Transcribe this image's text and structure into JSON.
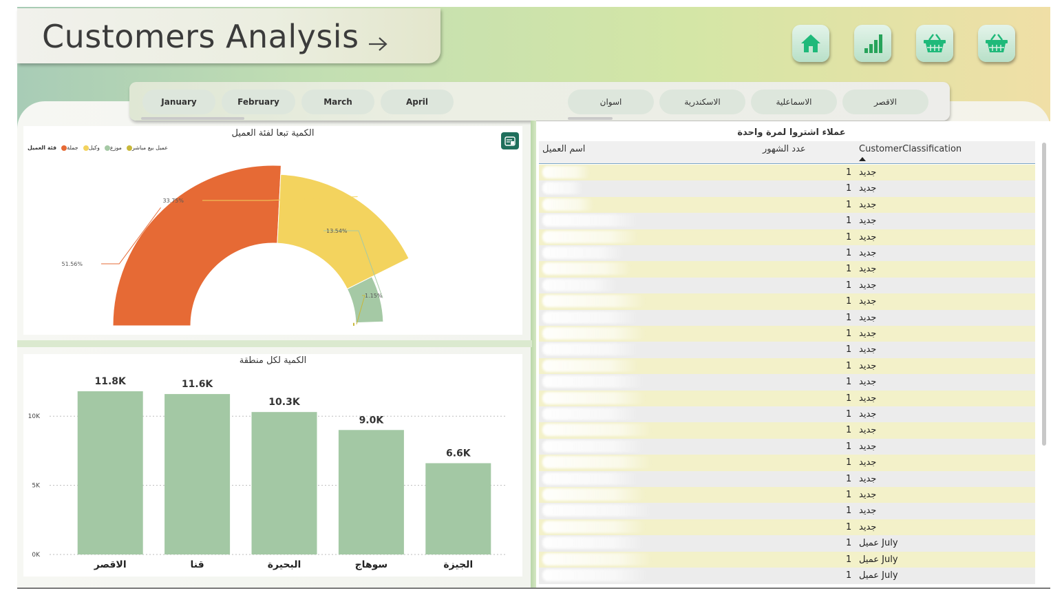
{
  "header": {
    "title": "Customers Analysis"
  },
  "nav": [
    {
      "icon": "home-icon"
    },
    {
      "icon": "bar-chart-icon"
    },
    {
      "icon": "basket-icon"
    },
    {
      "icon": "basket-icon"
    }
  ],
  "month_slicer": [
    "January",
    "February",
    "March",
    "April"
  ],
  "region_slicer": [
    "اسوان",
    "الاسكندرية",
    "الاسماعلية",
    "الاقصر"
  ],
  "colors": {
    "orange": "#e66a35",
    "yellow": "#f3d35e",
    "green": "#a5c9a5",
    "olive": "#c8b83a",
    "bar": "#a3c8a4",
    "accent": "#1f6f5c"
  },
  "donut_panel": {
    "title": "الكمية تبعا لفئة العميل",
    "legend_title": "فئة العميل",
    "legend": [
      {
        "label": "جملة",
        "color": "#e66a35"
      },
      {
        "label": "وكيل",
        "color": "#f3d35e"
      },
      {
        "label": "موزع",
        "color": "#a5c9a5"
      },
      {
        "label": "عميل بيع مباشر",
        "color": "#c8b83a"
      }
    ]
  },
  "bar_panel": {
    "title": "الكمية لكل منطقة"
  },
  "table": {
    "title": "عملاء اشتروا لمرة واحدة",
    "headers": {
      "name": "اسم العميل",
      "months": "عدد الشهور",
      "classification": "CustomerClassification"
    },
    "rows": [
      {
        "months": "1",
        "cls": "جديد"
      },
      {
        "months": "1",
        "cls": "جديد"
      },
      {
        "months": "1",
        "cls": "جديد"
      },
      {
        "months": "1",
        "cls": "جديد"
      },
      {
        "months": "1",
        "cls": "جديد"
      },
      {
        "months": "1",
        "cls": "جديد"
      },
      {
        "months": "1",
        "cls": "جديد"
      },
      {
        "months": "1",
        "cls": "جديد"
      },
      {
        "months": "1",
        "cls": "جديد"
      },
      {
        "months": "1",
        "cls": "جديد"
      },
      {
        "months": "1",
        "cls": "جديد"
      },
      {
        "months": "1",
        "cls": "جديد"
      },
      {
        "months": "1",
        "cls": "جديد"
      },
      {
        "months": "1",
        "cls": "جديد"
      },
      {
        "months": "1",
        "cls": "جديد"
      },
      {
        "months": "1",
        "cls": "جديد"
      },
      {
        "months": "1",
        "cls": "جديد"
      },
      {
        "months": "1",
        "cls": "جديد"
      },
      {
        "months": "1",
        "cls": "جديد"
      },
      {
        "months": "1",
        "cls": "جديد"
      },
      {
        "months": "1",
        "cls": "جديد"
      },
      {
        "months": "1",
        "cls": "جديد"
      },
      {
        "months": "1",
        "cls": "جديد"
      },
      {
        "months": "1",
        "cls": "عميل July"
      },
      {
        "months": "1",
        "cls": "عميل July"
      },
      {
        "months": "1",
        "cls": "عميل July"
      }
    ]
  },
  "chart_data": [
    {
      "type": "pie",
      "title": "الكمية تبعا لفئة العميل",
      "categories": [
        "جملة",
        "وكيل",
        "موزع",
        "عميل بيع مباشر"
      ],
      "values": [
        51.56,
        33.75,
        13.54,
        1.15
      ],
      "labels": [
        "51.56%",
        "33.75%",
        "13.54%",
        "1.15%"
      ],
      "legend": "top-left"
    },
    {
      "type": "bar",
      "title": "الكمية لكل منطقة",
      "categories": [
        "الاقصر",
        "قنا",
        "البحيرة",
        "سوهاج",
        "الجيزة"
      ],
      "values": [
        11800,
        11600,
        10300,
        9000,
        6600
      ],
      "labels": [
        "11.8K",
        "11.6K",
        "10.3K",
        "9.0K",
        "6.6K"
      ],
      "yticks": [
        "0K",
        "5K",
        "10K"
      ],
      "ylim": [
        0,
        12500
      ],
      "grid": true
    }
  ]
}
